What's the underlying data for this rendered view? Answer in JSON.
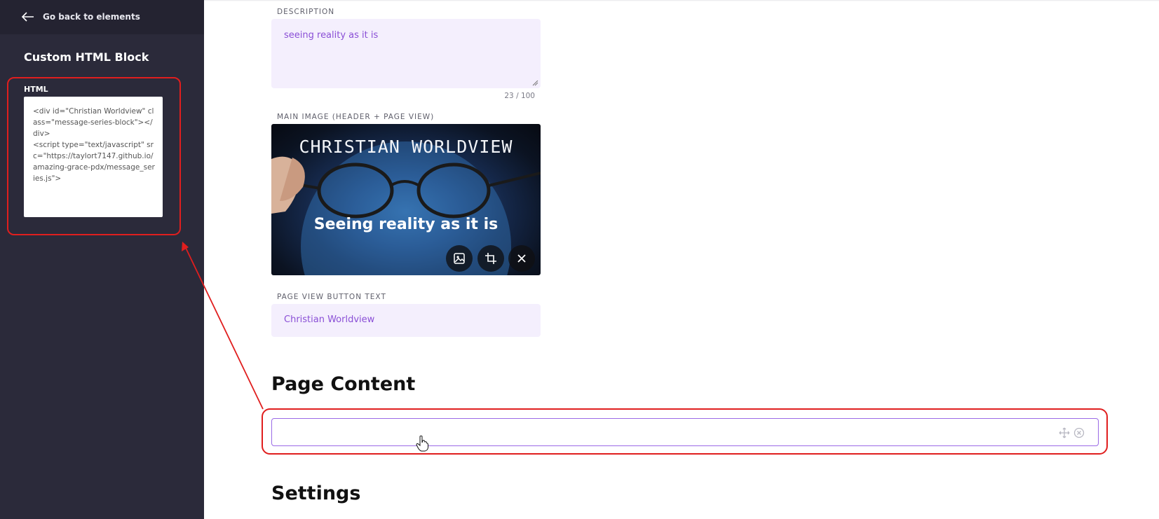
{
  "sidebar": {
    "back_label": "Go back to elements",
    "panel_title": "Custom HTML Block",
    "html_label": "HTML",
    "html_code": "<div id=\"Christian Worldview\" class=\"message-series-block\"></div>\n<script type=\"text/javascript\" src=\"https://taylort7147.github.io/amazing-grace-pdx/message_series.js\">"
  },
  "main": {
    "description": {
      "label": "DESCRIPTION",
      "value": "seeing reality as it is",
      "counter": "23 / 100"
    },
    "main_image": {
      "label": "MAIN IMAGE (HEADER + PAGE VIEW)",
      "title_text": "CHRISTIAN WORLDVIEW",
      "subtitle_text": "Seeing reality as it is",
      "buttons": [
        "image-icon",
        "crop-icon",
        "close-icon"
      ]
    },
    "page_view_button": {
      "label": "PAGE VIEW BUTTON TEXT",
      "value": "Christian Worldview"
    },
    "page_content_heading": "Page Content",
    "settings_heading": "Settings"
  },
  "colors": {
    "sidebar_bg": "#2b2a3a",
    "field_bg": "#f4effd",
    "field_text": "#8a4fd6",
    "annotation": "#e01e1e",
    "block_border": "#9a6ae6"
  }
}
